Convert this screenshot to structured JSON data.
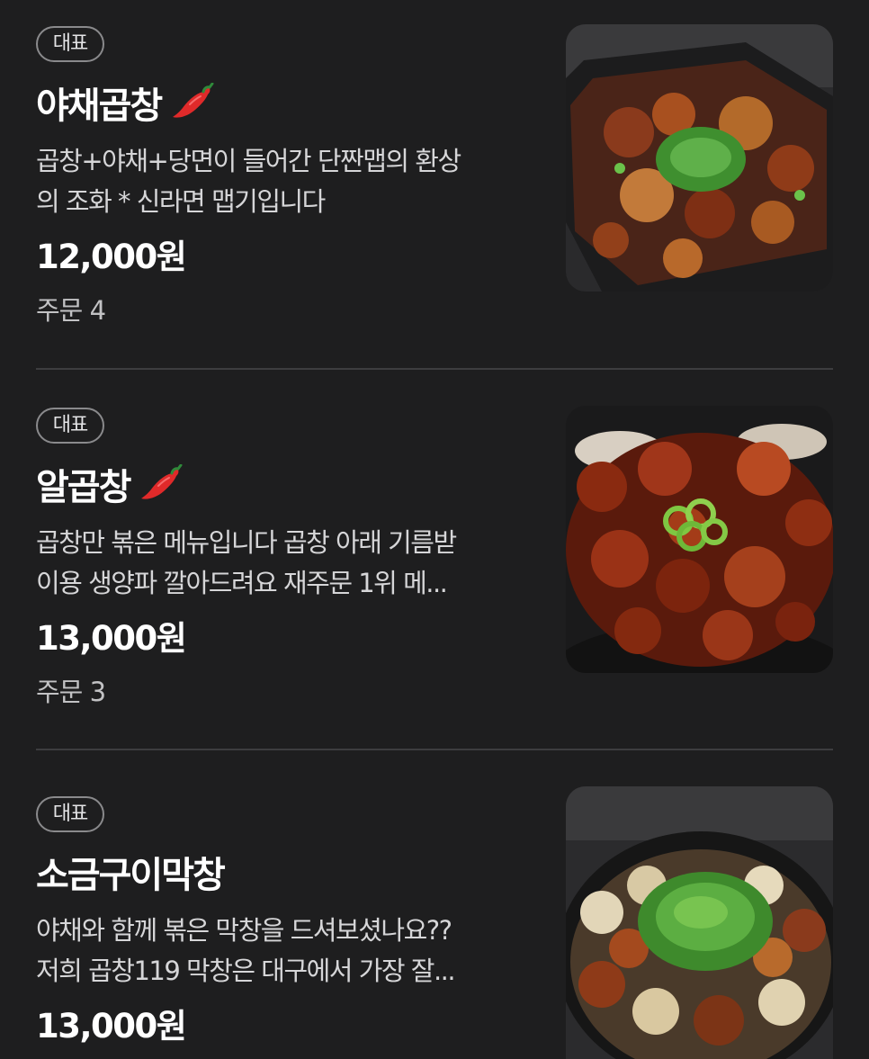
{
  "menu": {
    "items": [
      {
        "badge": "대표",
        "name": "야채곱창",
        "spicy": true,
        "icon": "chili-pepper-icon",
        "description_lines": [
          "곱창+야채+당면이 들어간 단짠맵의 환상",
          "의 조화 * 신라면 맵기입니다"
        ],
        "price": "12,000원",
        "orders": "주문 4"
      },
      {
        "badge": "대표",
        "name": "알곱창",
        "spicy": true,
        "icon": "chili-pepper-icon",
        "description_lines": [
          "곱창만 볶은 메뉴입니다 곱창 아래 기름받",
          "이용 생양파 깔아드려요 재주문 1위 메..."
        ],
        "price": "13,000원",
        "orders": "주문 3"
      },
      {
        "badge": "대표",
        "name": "소금구이막창",
        "spicy": false,
        "description_lines": [
          "야채와 함께 볶은 막창을 드셔보셨나요??",
          "저희 곱창119 막창은 대구에서 가장 잘..."
        ],
        "price": "13,000원"
      }
    ]
  },
  "colors": {
    "background": "#1e1e1f",
    "divider": "#3d3d3f",
    "badge_border": "#8a8a8c",
    "pepper": "#e02a2a"
  }
}
